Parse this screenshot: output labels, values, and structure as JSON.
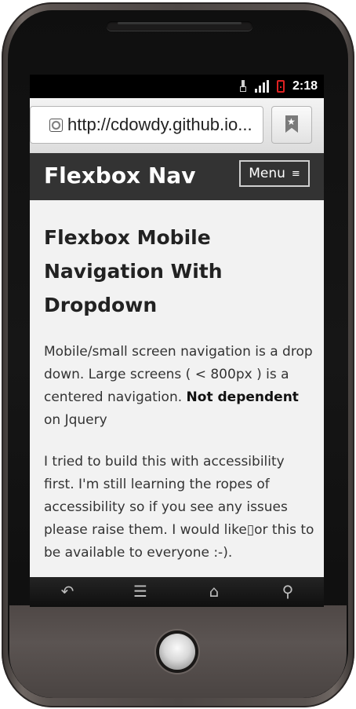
{
  "status_bar": {
    "time": "2:18",
    "icons": [
      "usb-icon",
      "signal-icon",
      "battery-icon"
    ],
    "battery_color": "#e02222"
  },
  "browser": {
    "url": "http://cdowdy.github.io...",
    "icons": [
      "globe-icon",
      "bookmark-icon"
    ]
  },
  "site_header": {
    "title": "Flexbox Nav",
    "menu_label": "Menu",
    "menu_icon": "≡",
    "background": "#333333"
  },
  "content": {
    "heading": "Flexbox Mobile Navigation With Dropdown",
    "paragraph1_text": "Mobile/small screen navigation is a drop down. Large screens ( < 800px ) is a centered navigation.",
    "paragraph1_bold": "Not dependent",
    "paragraph1_tail": "on Jquery",
    "paragraph2": "I tried to build this with accessibility first. I'm still learning the ropes of accessibility so if you see any issues please raise them. I would like▯or this to be available to everyone :-)."
  },
  "device_nav": {
    "back_icon": "↶",
    "menu_icon": "☰",
    "home_icon": "⌂",
    "search_icon": "⚲"
  }
}
